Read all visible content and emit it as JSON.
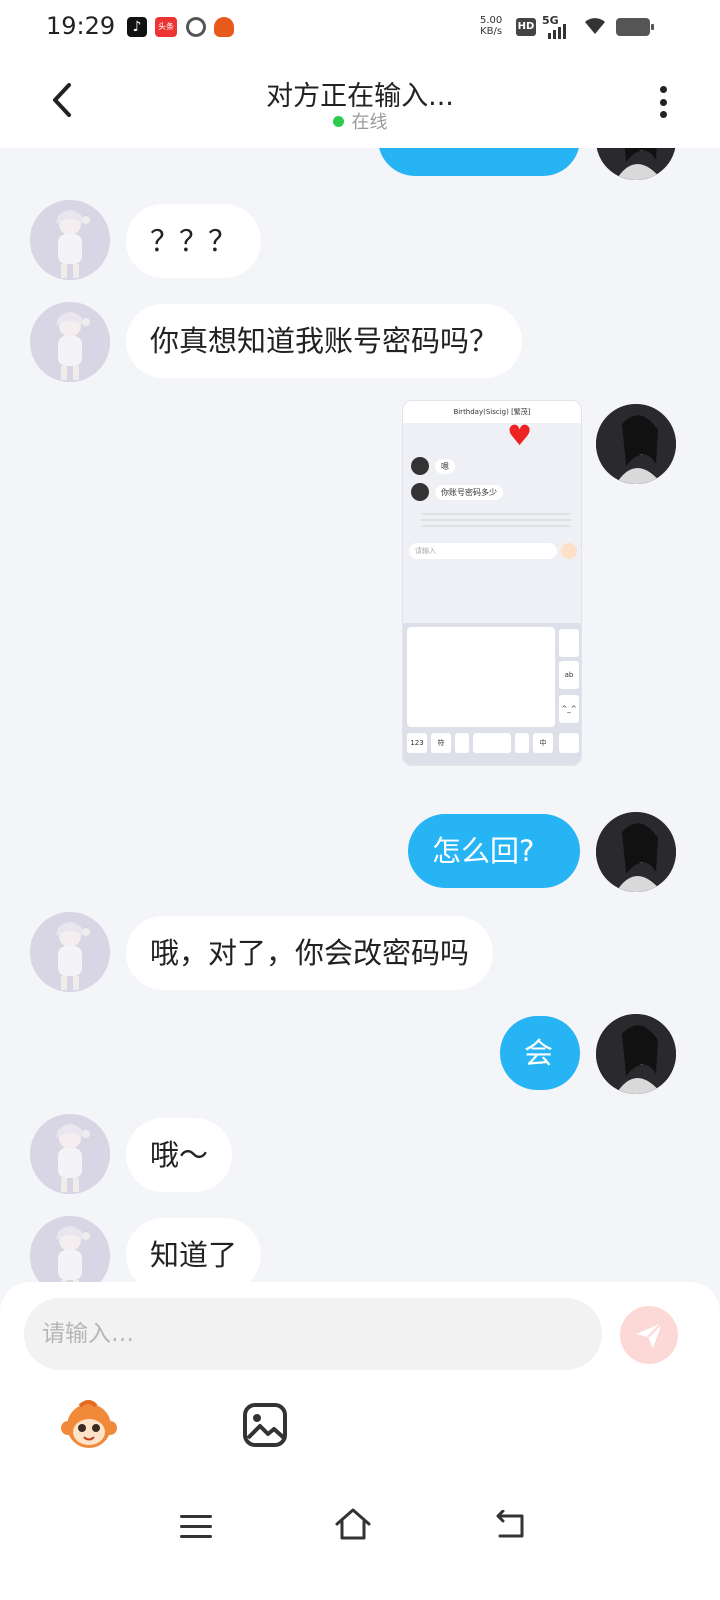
{
  "status_bar": {
    "time": "19:29",
    "net_speed_top": "5.00",
    "net_speed_bottom": "KB/s",
    "hd": "HD",
    "network": "5G",
    "apps": [
      "tiktok-icon",
      "news-icon",
      "ring-app-icon",
      "fox-app-icon"
    ]
  },
  "header": {
    "title": "对方正在输入...",
    "status": "在线",
    "online_color": "#2ccb4c"
  },
  "messages": [
    {
      "side": "peer",
      "text": "？？？"
    },
    {
      "side": "peer",
      "text": "你真想知道我账号密码吗？"
    },
    {
      "side": "me",
      "type": "image"
    },
    {
      "side": "me",
      "text": "怎么回?"
    },
    {
      "side": "peer",
      "text": "哦，对了，你会改密码吗"
    },
    {
      "side": "me",
      "text": "会"
    },
    {
      "side": "peer",
      "text": "哦～"
    },
    {
      "side": "peer",
      "text": "知道了"
    }
  ],
  "embedded_image": {
    "header": "Birthday(Siscig) [繁茂]",
    "row1": "嗯",
    "row2": "你账号密码多少",
    "input_placeholder": "请输入",
    "keys": [
      "123",
      "符",
      "中",
      "ab",
      "^_^"
    ]
  },
  "input": {
    "placeholder": "请输入…"
  },
  "colors": {
    "my_bubble": "#27b4f5",
    "background": "#f4f5f8",
    "send_button": "#fcd9d6"
  },
  "toolbar": {
    "icons": [
      "monkey-emoji-icon",
      "image-icon"
    ]
  },
  "nav": {
    "icons": [
      "menu-icon",
      "home-icon",
      "back-icon"
    ]
  }
}
